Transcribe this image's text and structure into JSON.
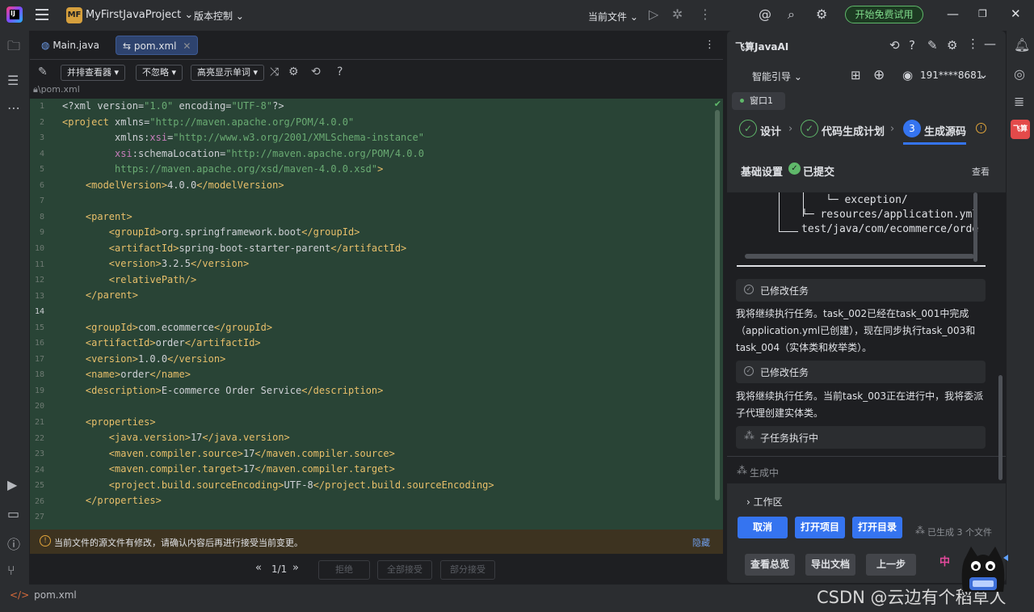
{
  "titlebar": {
    "project_badge": "MF",
    "project_name": "MyFirstJavaProject",
    "vcs_label": "版本控制",
    "run_config": "当前文件",
    "trial_button": "开始免费试用"
  },
  "editor": {
    "tabs": [
      {
        "label": "Main.java",
        "active": false
      },
      {
        "label": "pom.xml",
        "active": true
      }
    ],
    "toolbar": {
      "viewer_mode": "并排查看器",
      "ignore_mode": "不忽略",
      "highlight_mode": "高亮显示单词"
    },
    "breadcrumb": "\\pom.xml",
    "line_numbers": [
      "1",
      "2",
      "3",
      "4",
      "5",
      "6",
      "7",
      "8",
      "9",
      "10",
      "11",
      "12",
      "13",
      "14",
      "15",
      "16",
      "17",
      "18",
      "19",
      "20",
      "21",
      "22",
      "23",
      "24",
      "25",
      "26",
      "27"
    ],
    "current_line": "14",
    "warning_text": "当前文件的源文件有修改，请确认内容后再进行接受当前变更。",
    "warning_hide": "隐藏",
    "diff_counter": "1/1",
    "reject_label": "拒绝",
    "accept_all_label": "全部接受",
    "accept_partial_label": "部分接受"
  },
  "ai_panel": {
    "title": "飞算JavaAI",
    "guide_label": "智能引导",
    "user": "191****8681",
    "window_tab": "窗口1",
    "steps": [
      {
        "label": "设计",
        "status": "done"
      },
      {
        "label": "代码生成计划",
        "status": "done"
      },
      {
        "label": "生成源码",
        "status": "current",
        "number": "3"
      }
    ],
    "basic_settings": "基础设置",
    "submitted": "已提交",
    "view_label": "查看",
    "tree_lines": [
      "└─ exception/",
      "└─ resources/application.yml",
      "test/java/com/ecommerce/order"
    ],
    "task1_label": "已修改任务",
    "msg1": "我将继续执行任务。task_002已经在task_001中完成（application.yml已创建），现在同步执行task_003和task_004（实体类和枚举类）。",
    "task2_label": "已修改任务",
    "msg2": "我将继续执行任务。当前task_003正在进行中，我将委派子代理创建实体类。",
    "subtask_label": "子任务执行中",
    "generating_label": "生成中",
    "workspace_label": "工作区",
    "cancel_label": "取消",
    "open_project_label": "打开项目",
    "open_dir_label": "打开目录",
    "generated_count": "已生成 3 个文件",
    "view_summary_label": "查看总览",
    "export_doc_label": "导出文档",
    "prev_step_label": "上一步",
    "brand_badge": "飞算"
  },
  "statusbar": {
    "file": "pom.xml",
    "watermark": "CSDN @云边有个稻草人",
    "mascot_label": "中"
  },
  "colors": {
    "accent_blue": "#3574f0",
    "success_green": "#5fb86a",
    "diff_bg": "#294436",
    "warning_bg": "#3d3320"
  }
}
